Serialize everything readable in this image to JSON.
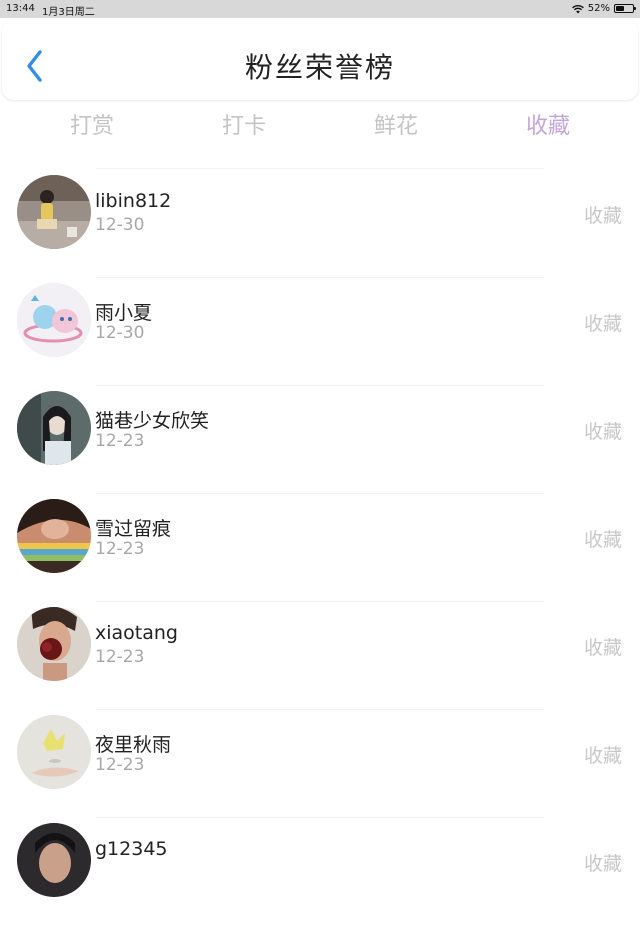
{
  "status_bar": {
    "time": "13:44",
    "date": "1月3日周二",
    "battery": "52%",
    "battery_level": 0.52
  },
  "nav": {
    "title": "粉丝荣誉榜",
    "back_icon": "chevron-left-icon"
  },
  "tabs": [
    {
      "label": "打赏",
      "active": false
    },
    {
      "label": "打卡",
      "active": false
    },
    {
      "label": "鲜花",
      "active": false
    },
    {
      "label": "收藏",
      "active": true
    }
  ],
  "colors": {
    "accent": "#c6a4dc",
    "back_icon": "#2f8ee8",
    "muted": "#c8c8c8"
  },
  "list": {
    "items": [
      {
        "name": "libin812",
        "date": "12-30",
        "action": "收藏"
      },
      {
        "name": "雨小夏",
        "date": "12-30",
        "action": "收藏"
      },
      {
        "name": "猫巷少女欣笑",
        "date": "12-23",
        "action": "收藏"
      },
      {
        "name": "雪过留痕",
        "date": "12-23",
        "action": "收藏"
      },
      {
        "name": "xiaotang",
        "date": "12-23",
        "action": "收藏"
      },
      {
        "name": "夜里秋雨",
        "date": "12-23",
        "action": "收藏"
      },
      {
        "name": "g12345",
        "date": "",
        "action": "收藏"
      }
    ]
  }
}
